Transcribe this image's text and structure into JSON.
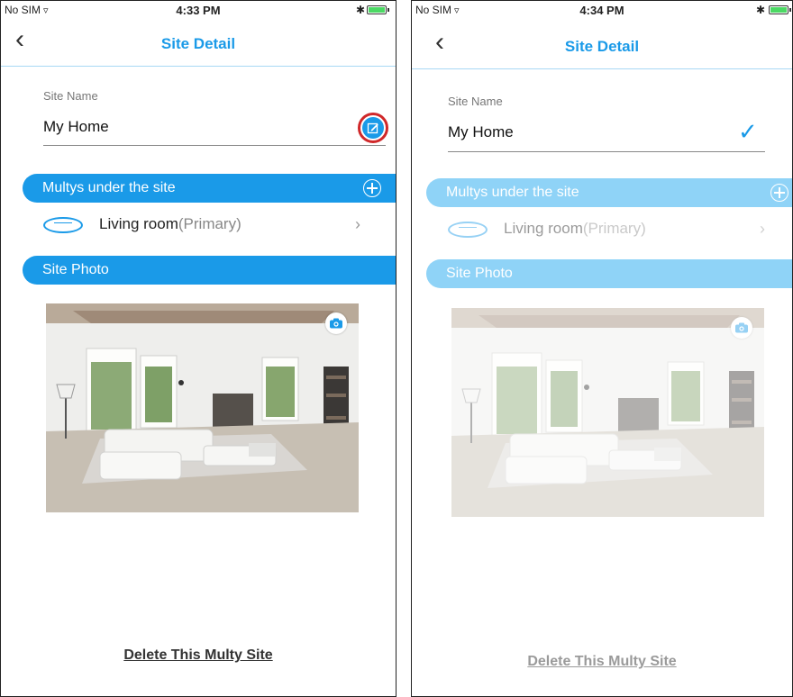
{
  "screens": [
    {
      "status": {
        "carrier": "No SIM",
        "time": "4:33 PM"
      },
      "nav": {
        "title": "Site Detail"
      },
      "site_name": {
        "label": "Site Name",
        "value": "My Home"
      },
      "multys": {
        "header": "Multys under the site",
        "items": [
          {
            "name": "Living room",
            "sub": "(Primary)"
          }
        ]
      },
      "photo": {
        "header": "Site Photo"
      },
      "delete_label": "Delete This Multy Site"
    },
    {
      "status": {
        "carrier": "No SIM",
        "time": "4:34 PM"
      },
      "nav": {
        "title": "Site Detail"
      },
      "site_name": {
        "label": "Site Name",
        "value": "My Home"
      },
      "multys": {
        "header": "Multys under the site",
        "items": [
          {
            "name": "Living room",
            "sub": "(Primary)"
          }
        ]
      },
      "photo": {
        "header": "Site Photo"
      },
      "delete_label": "Delete This Multy Site"
    }
  ],
  "colors": {
    "accent": "#1a9ae8",
    "accent_dim": "#8fd3f7",
    "highlight_ring": "#d0282a"
  },
  "icons": {
    "back": "chevron-left-icon",
    "edit": "edit-icon",
    "confirm": "checkmark-icon",
    "add": "plus-circle-icon",
    "device": "router-icon",
    "camera": "camera-icon",
    "row_arrow": "chevron-right-icon"
  }
}
